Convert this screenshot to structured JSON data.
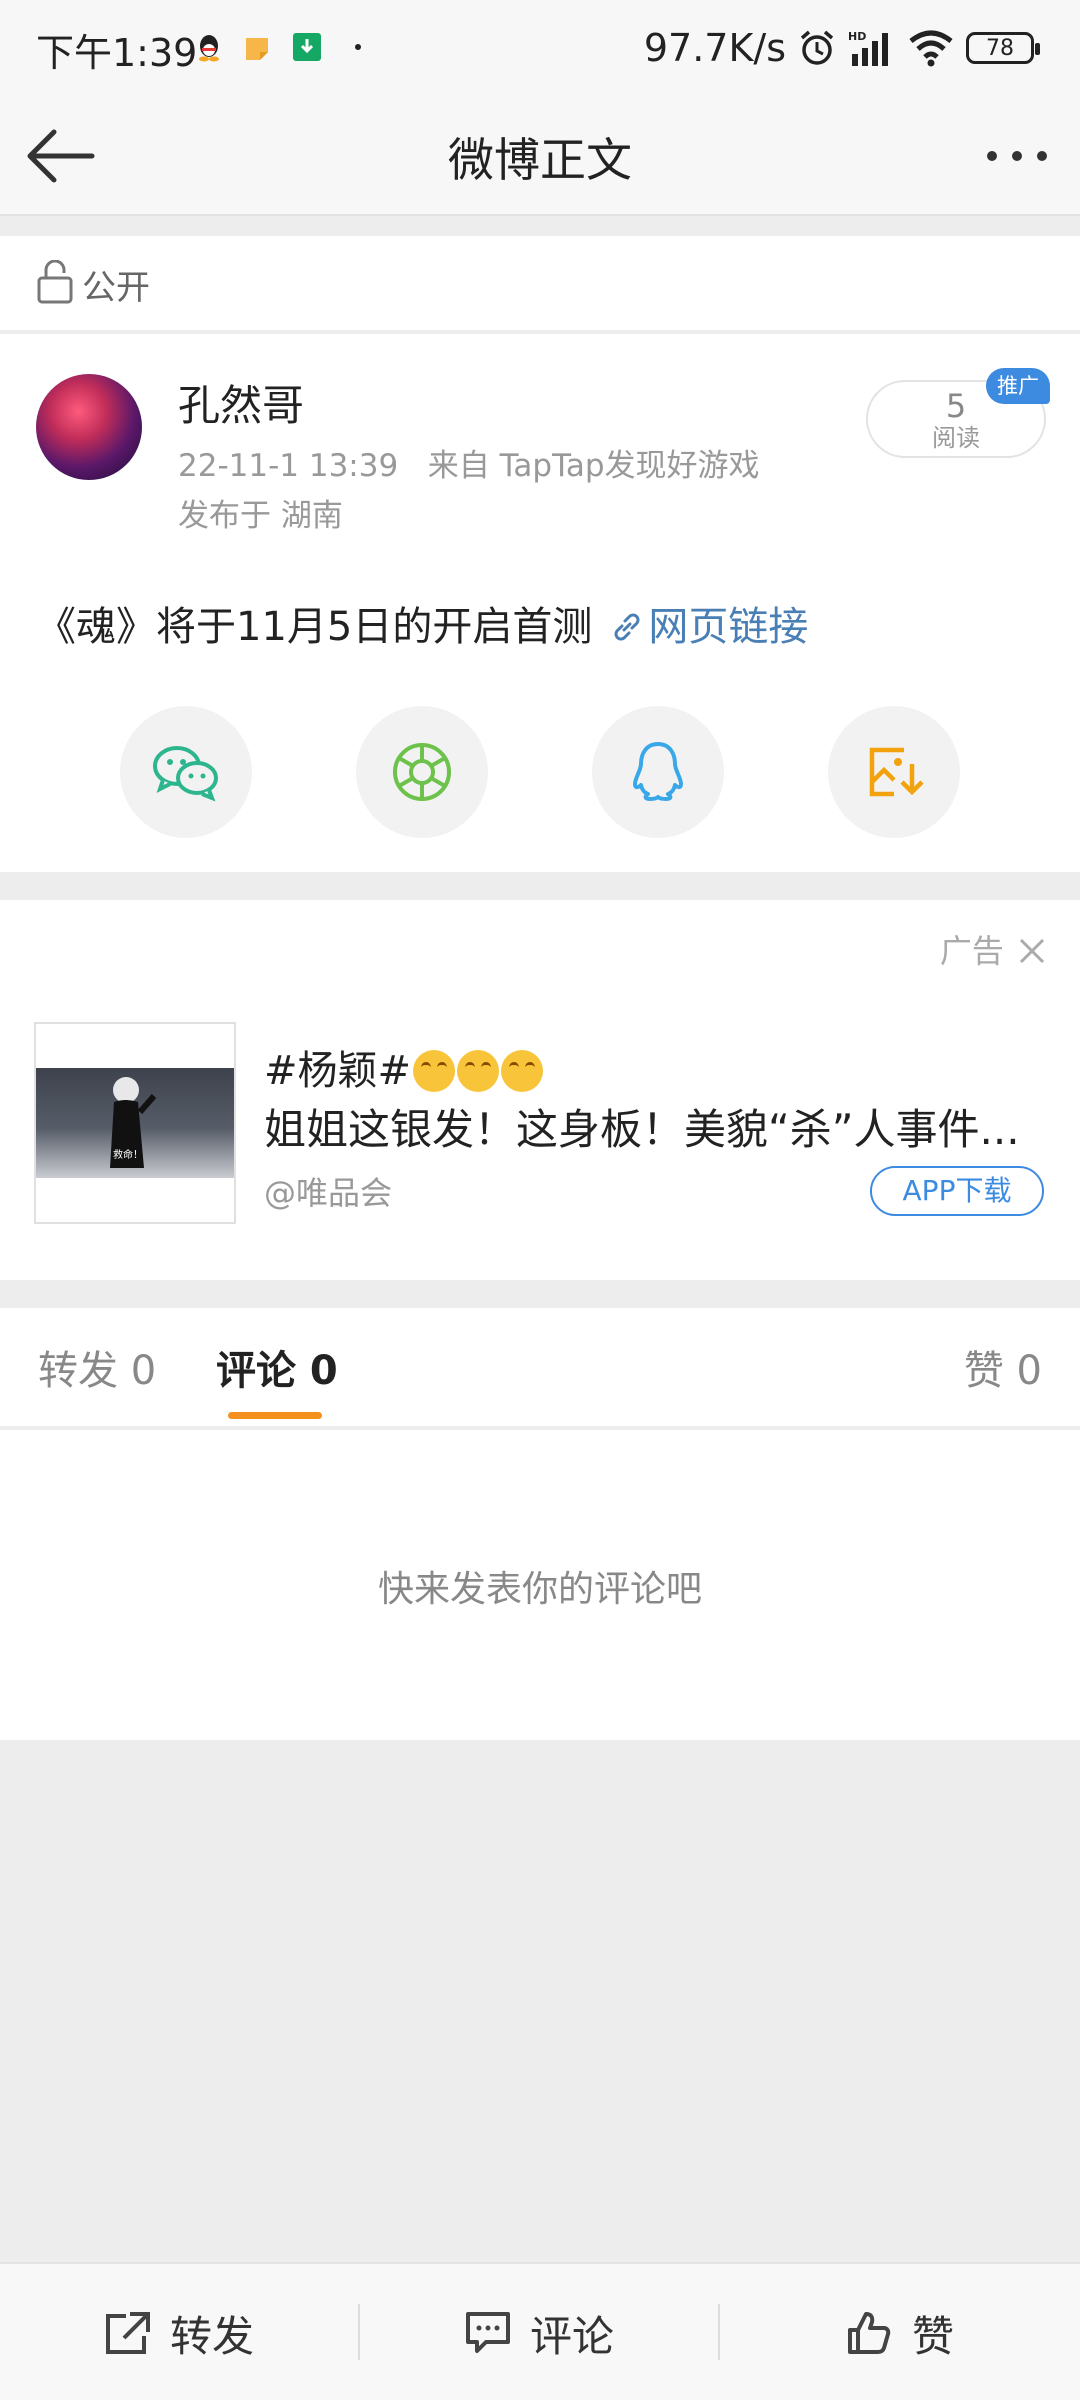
{
  "status_bar": {
    "time": "下午1:39",
    "net_speed": "97.7K/s",
    "battery": "78"
  },
  "nav": {
    "title": "微博正文"
  },
  "visibility": {
    "label": "公开"
  },
  "post": {
    "author": "孔然哥",
    "timestamp": "22-11-1 13:39",
    "source": "来自 TapTap发现好游戏",
    "location": "发布于 湖南",
    "reads_count": "5",
    "reads_label": "阅读",
    "promo_badge": "推广",
    "text": "《魂》将于11月5日的开启首测",
    "link_text": "网页链接"
  },
  "share_targets": [
    {
      "name": "wechat-icon"
    },
    {
      "name": "moments-icon"
    },
    {
      "name": "qq-icon"
    },
    {
      "name": "save-image-icon"
    }
  ],
  "ad": {
    "label": "广告",
    "hashtag": "#杨颖#",
    "headline": "姐姐这银发！这身板！美貌“杀”人事件...",
    "brand": "@唯品会",
    "download_label": "APP下载",
    "thumb_caption": "救命！"
  },
  "tabs": {
    "repost": "转发 0",
    "comment": "评论 0",
    "like": "赞 0"
  },
  "empty_message": "快来发表你的评论吧",
  "bottom_bar": {
    "repost": "转发",
    "comment": "评论",
    "like": "赞"
  },
  "colors": {
    "accent_orange": "#f4901e",
    "link_blue": "#4a7fb5",
    "promo_blue": "#3d8be0"
  }
}
